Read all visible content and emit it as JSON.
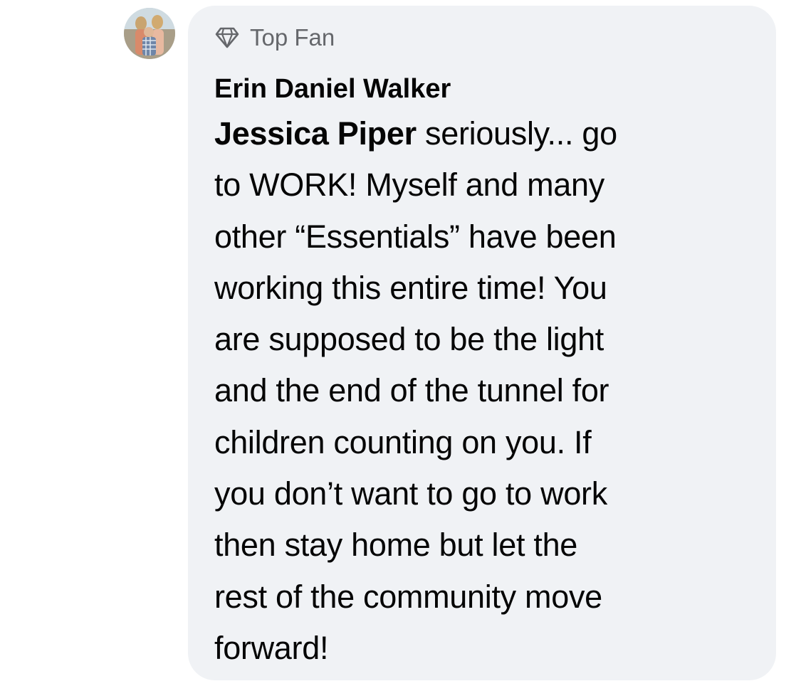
{
  "comment": {
    "avatar_icon": "user-avatar-photo",
    "badge": {
      "icon": "diamond-icon",
      "label": "Top Fan"
    },
    "author": "Erin Daniel Walker",
    "mention": "Jessica Piper",
    "lines": [
      " seriously... go",
      "to WORK! Myself and many",
      "other “Essentials” have been",
      "working this entire time! You",
      "are supposed to be the light",
      "and the end of the tunnel for",
      "children counting on you. If",
      "you don’t want to go to work",
      "then stay home but let the",
      "rest of the community move",
      "forward!"
    ],
    "colors": {
      "bubble": "#f0f2f5",
      "text": "#050505",
      "secondary": "#65676b"
    }
  }
}
